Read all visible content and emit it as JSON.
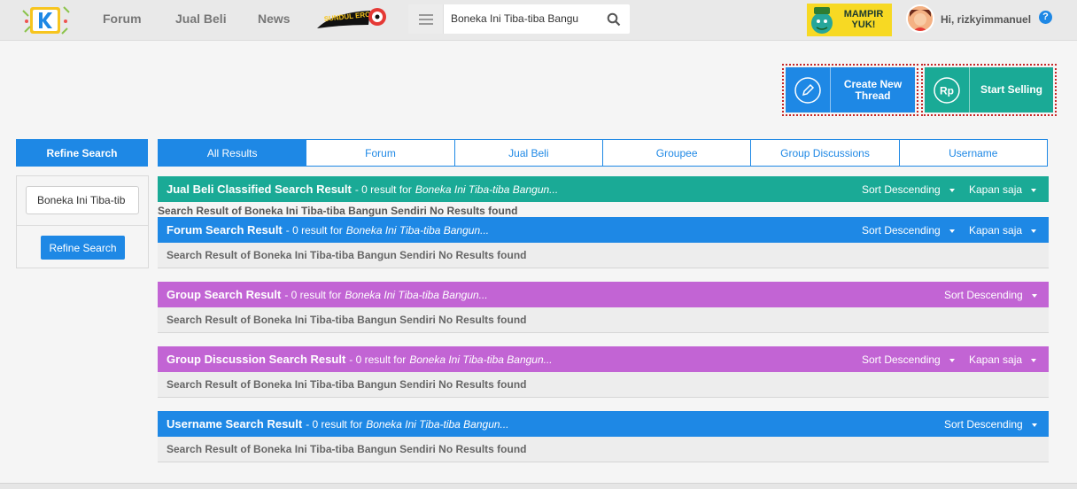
{
  "header": {
    "nav": [
      {
        "label": "Forum"
      },
      {
        "label": "Jual Beli"
      },
      {
        "label": "News"
      }
    ],
    "sundul_text": "SUNDUL EROPA",
    "search_value": "Boneka Ini Tiba-tiba Bangu",
    "mampir_text": "MAMPIR YUK!",
    "greeting": "Hi, rizkyimmanuel",
    "help_symbol": "?"
  },
  "actions": {
    "create_label": "Create New Thread",
    "sell_label": "Start Selling",
    "sell_icon_text": "Rp"
  },
  "sidebar": {
    "head_label": "Refine Search",
    "input_value": "Boneka Ini Tiba-tib",
    "button_label": "Refine Search"
  },
  "tabs": [
    {
      "label": "All Results"
    },
    {
      "label": "Forum"
    },
    {
      "label": "Jual Beli"
    },
    {
      "label": "Groupee"
    },
    {
      "label": "Group Discussions"
    },
    {
      "label": "Username"
    }
  ],
  "sections": [
    {
      "title": "Jual Beli Classified Search Result",
      "count": "- 0 result for",
      "query": "Boneka Ini Tiba-tiba Bangun...",
      "sort": "Sort Descending",
      "filter": "Kapan saja",
      "body": "Search Result of Boneka Ini Tiba-tiba Bangun Sendiri No Results found",
      "color": "#1aaa96"
    },
    {
      "title": "Forum Search Result",
      "count": "- 0 result for",
      "query": "Boneka Ini Tiba-tiba Bangun...",
      "sort": "Sort Descending",
      "filter": "Kapan saja",
      "body": "Search Result of Boneka Ini Tiba-tiba Bangun Sendiri No Results found",
      "color": "#1e88e5"
    },
    {
      "title": "Group Search Result",
      "count": "- 0 result for",
      "query": "Boneka Ini Tiba-tiba Bangun...",
      "sort": "Sort Descending",
      "filter": "",
      "body": "Search Result of Boneka Ini Tiba-tiba Bangun Sendiri No Results found",
      "color": "#c264d4"
    },
    {
      "title": "Group Discussion Search Result",
      "count": "- 0 result for",
      "query": "Boneka Ini Tiba-tiba Bangun...",
      "sort": "Sort Descending",
      "filter": "Kapan saja",
      "body": "Search Result of Boneka Ini Tiba-tiba Bangun Sendiri No Results found",
      "color": "#c264d4"
    },
    {
      "title": "Username Search Result",
      "count": "- 0 result for",
      "query": "Boneka Ini Tiba-tiba Bangun...",
      "sort": "Sort Descending",
      "filter": "",
      "body": "Search Result of Boneka Ini Tiba-tiba Bangun Sendiri No Results found",
      "color": "#1e88e5"
    }
  ]
}
